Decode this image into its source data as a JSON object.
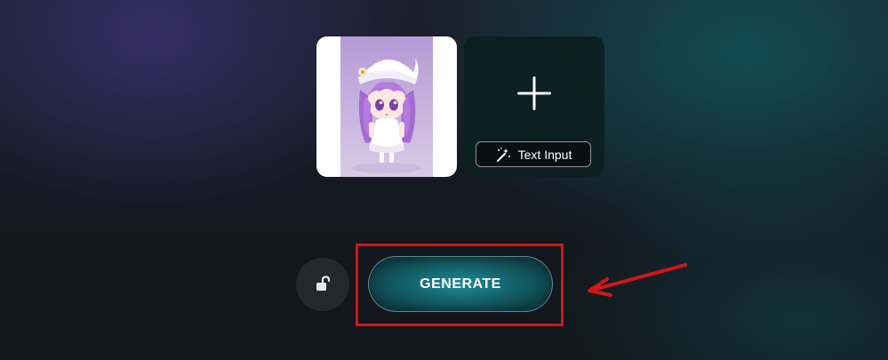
{
  "upload": {
    "thumbnail_alt": "chibi character with purple hair",
    "thumbnail_icon": "image-thumbnail",
    "add_icon": "plus-icon",
    "text_input_icon": "magic-wand-icon",
    "text_input_label": "Text Input"
  },
  "controls": {
    "lock_icon": "unlock-icon",
    "generate_label": "GENERATE"
  },
  "annotation": {
    "highlight_color": "#d11717",
    "arrow_icon": "arrow-left-icon"
  },
  "colors": {
    "generate_fill": "#1e8a96",
    "background_dark": "#141820",
    "accent_teal": "#125056",
    "accent_purple": "#3a306e"
  }
}
